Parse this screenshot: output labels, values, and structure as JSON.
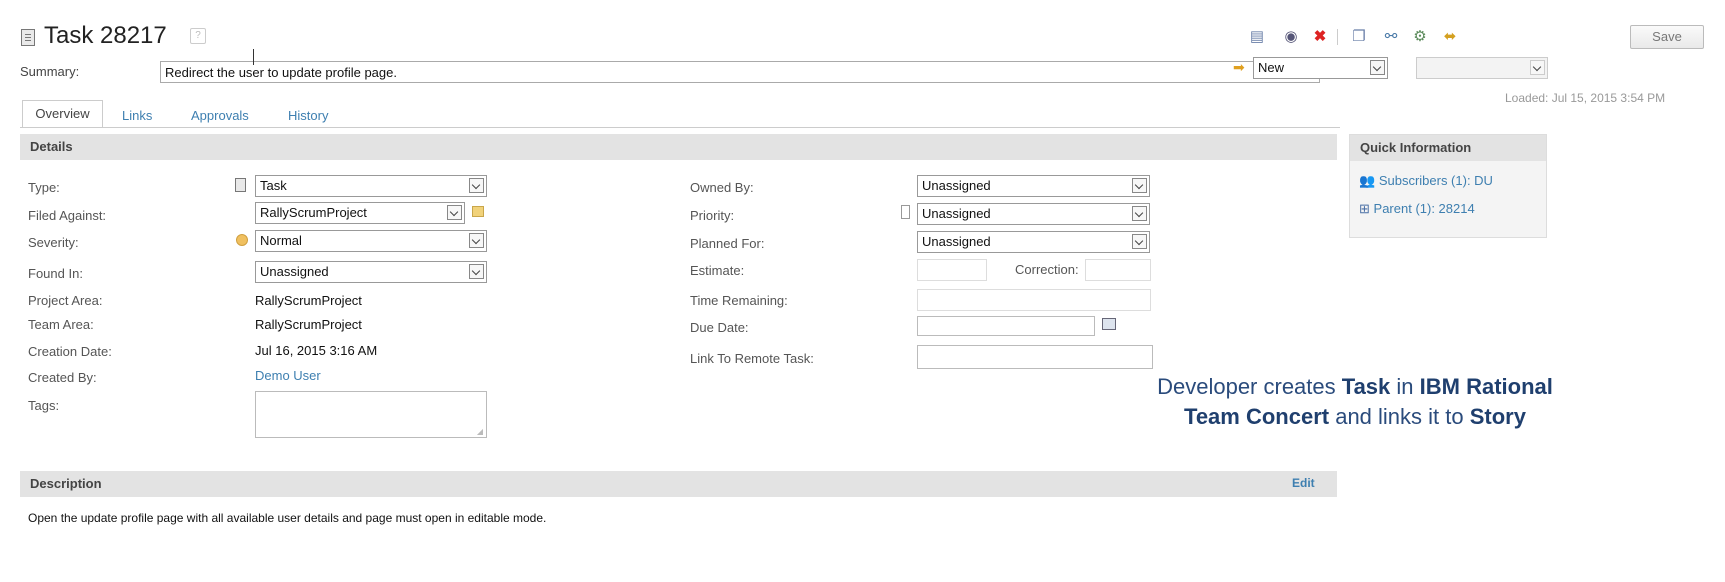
{
  "header": {
    "title": "Task 28217",
    "summary_label": "Summary:",
    "summary_value": "Redirect the user to update profile page.",
    "save_label": "Save",
    "state_value": "New",
    "loaded_text": "Loaded: Jul 15, 2015 3:54 PM"
  },
  "tabs": [
    {
      "label": "Overview",
      "active": true
    },
    {
      "label": "Links"
    },
    {
      "label": "Approvals"
    },
    {
      "label": "History"
    }
  ],
  "details": {
    "section_title": "Details",
    "left": {
      "type_label": "Type:",
      "type_value": "Task",
      "filed_against_label": "Filed Against:",
      "filed_against_value": "RallyScrumProject",
      "severity_label": "Severity:",
      "severity_value": "Normal",
      "found_in_label": "Found In:",
      "found_in_value": "Unassigned",
      "project_area_label": "Project Area:",
      "project_area_value": "RallyScrumProject",
      "team_area_label": "Team Area:",
      "team_area_value": "RallyScrumProject",
      "creation_date_label": "Creation Date:",
      "creation_date_value": "Jul 16, 2015 3:16 AM",
      "created_by_label": "Created By:",
      "created_by_value": "Demo User",
      "tags_label": "Tags:"
    },
    "right": {
      "owned_by_label": "Owned By:",
      "owned_by_value": "Unassigned",
      "priority_label": "Priority:",
      "priority_value": "Unassigned",
      "planned_for_label": "Planned For:",
      "planned_for_value": "Unassigned",
      "estimate_label": "Estimate:",
      "correction_label": "Correction:",
      "time_remaining_label": "Time Remaining:",
      "due_date_label": "Due Date:",
      "link_remote_label": "Link To Remote Task:"
    }
  },
  "quick_info": {
    "title": "Quick Information",
    "subscribers": "Subscribers (1): DU",
    "parent": "Parent (1): 28214"
  },
  "description": {
    "section_title": "Description",
    "edit_label": "Edit",
    "text": "Open the update profile page with all available user details and page must open in editable mode."
  },
  "overlay": {
    "line1_a": "Developer creates ",
    "line1_b": "Task",
    "line1_c": " in ",
    "line1_d": "IBM Rational",
    "line2_a": "Team Concert",
    "line2_b": " and links it to ",
    "line2_c": "Story"
  },
  "colors": {
    "link": "#3e7fb0",
    "section_bar": "#e3e3e3",
    "overlay_text": "#2a4b7c"
  }
}
